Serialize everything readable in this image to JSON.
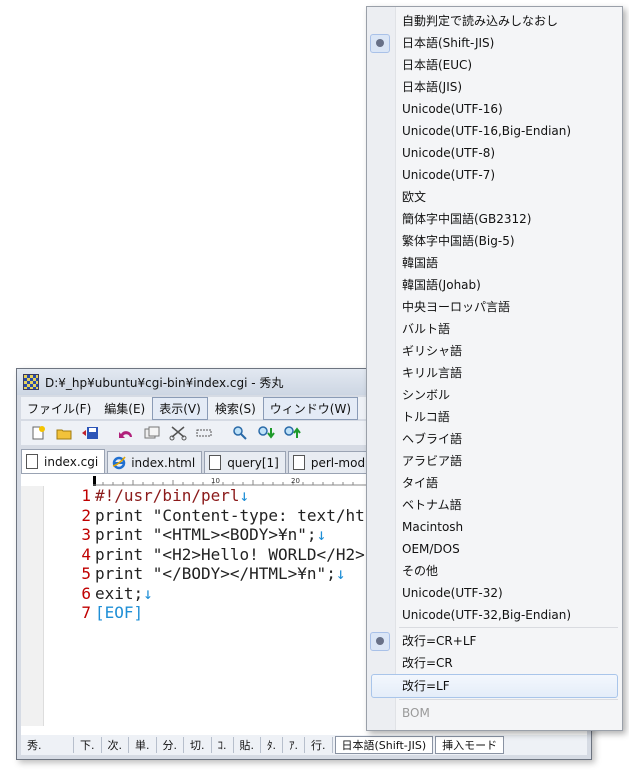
{
  "window": {
    "title": "D:¥_hp¥ubuntu¥cgi-bin¥index.cgi  - 秀丸"
  },
  "menubar": [
    "ファイル(F)",
    "編集(E)",
    "表示(V)",
    "検索(S)",
    "ウィンドウ(W)"
  ],
  "tabs": [
    {
      "label": "index.cgi",
      "icon": "document-icon"
    },
    {
      "label": "index.html",
      "icon": "ie-icon"
    },
    {
      "label": "query[1]",
      "icon": "document-icon"
    },
    {
      "label": "perl-mod",
      "icon": "document-icon"
    }
  ],
  "ruler": {
    "mark10": "10",
    "mark20": "20"
  },
  "code": [
    {
      "num": "1",
      "text": "#!/usr/bin/perl",
      "eol": "↓"
    },
    {
      "num": "2",
      "text": "print \"Content-type: text/ht",
      "eol": ""
    },
    {
      "num": "3",
      "text": "print \"<HTML><BODY>¥n\";",
      "eol": "↓"
    },
    {
      "num": "4",
      "text": "print \"<H2>Hello! WORLD</H2>",
      "eol": ""
    },
    {
      "num": "5",
      "text": "print \"</BODY></HTML>¥n\";",
      "eol": "↓"
    },
    {
      "num": "6",
      "text": "exit;",
      "eol": "↓"
    },
    {
      "num": "7",
      "text": "[EOF]",
      "eol": ""
    }
  ],
  "statusbar": [
    "秀.",
    "下.",
    "次.",
    "単.",
    "分.",
    "切.",
    "ｺ.",
    "貼.",
    "ﾀ.",
    "ｱ.",
    "行."
  ],
  "status_encoding": "日本語(Shift-JIS)",
  "status_mode": "挿入モード",
  "popup": {
    "items": [
      {
        "label": "自動判定で読み込みしなおし"
      },
      {
        "label": "日本語(Shift-JIS)",
        "checked": true
      },
      {
        "label": "日本語(EUC)"
      },
      {
        "label": "日本語(JIS)"
      },
      {
        "label": "Unicode(UTF-16)"
      },
      {
        "label": "Unicode(UTF-16,Big-Endian)"
      },
      {
        "label": "Unicode(UTF-8)"
      },
      {
        "label": "Unicode(UTF-7)"
      },
      {
        "label": "欧文"
      },
      {
        "label": "簡体字中国語(GB2312)"
      },
      {
        "label": "繁体字中国語(Big-5)"
      },
      {
        "label": "韓国語"
      },
      {
        "label": "韓国語(Johab)"
      },
      {
        "label": "中央ヨーロッパ言語"
      },
      {
        "label": "バルト語"
      },
      {
        "label": "ギリシャ語"
      },
      {
        "label": "キリル言語"
      },
      {
        "label": "シンボル"
      },
      {
        "label": "トルコ語"
      },
      {
        "label": "ヘブライ語"
      },
      {
        "label": "アラビア語"
      },
      {
        "label": "タイ語"
      },
      {
        "label": "ベトナム語"
      },
      {
        "label": "Macintosh"
      },
      {
        "label": "OEM/DOS"
      },
      {
        "label": "その他"
      },
      {
        "label": "Unicode(UTF-32)"
      },
      {
        "label": "Unicode(UTF-32,Big-Endian)"
      }
    ],
    "newline_items": [
      {
        "label": "改行=CR+LF",
        "checked": true
      },
      {
        "label": "改行=CR"
      },
      {
        "label": "改行=LF",
        "hover": true
      }
    ],
    "bom_label": "BOM"
  }
}
